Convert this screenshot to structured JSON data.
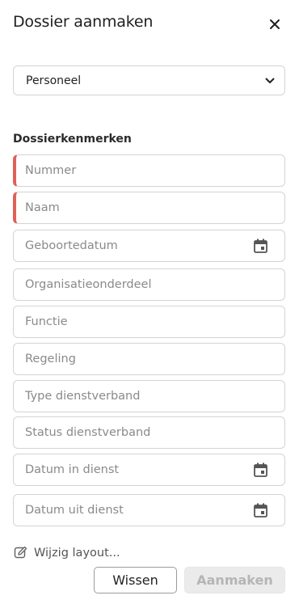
{
  "header": {
    "title": "Dossier aanmaken",
    "close_icon": "close-icon"
  },
  "type_select": {
    "value": "Personeel",
    "icon": "chevron-down-icon"
  },
  "section": {
    "heading": "Dossierkenmerken"
  },
  "fields": [
    {
      "placeholder": "Nummer",
      "required": true
    },
    {
      "placeholder": "Naam",
      "required": true
    },
    {
      "placeholder": "Geboortedatum",
      "icon": "calendar-icon"
    },
    {
      "placeholder": "Organisatieonderdeel"
    },
    {
      "placeholder": "Functie"
    },
    {
      "placeholder": "Regeling"
    },
    {
      "placeholder": "Type dienstverband"
    },
    {
      "placeholder": "Status dienstverband"
    },
    {
      "placeholder": "Datum in dienst",
      "icon": "calendar-icon"
    },
    {
      "placeholder": "Datum uit dienst",
      "icon": "calendar-icon"
    }
  ],
  "layout_link": {
    "label": "Wijzig layout...",
    "icon": "edit-icon"
  },
  "actions": {
    "clear_label": "Wissen",
    "create_label": "Aanmaken"
  },
  "colors": {
    "required_marker": "#e0605a",
    "border": "#d4d4d4",
    "placeholder": "#8a8a8a",
    "disabled_bg": "#ebebeb"
  }
}
